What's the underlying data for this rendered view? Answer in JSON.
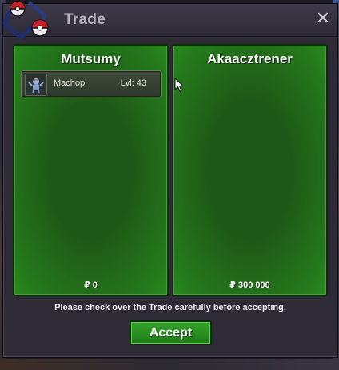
{
  "window": {
    "title": "Trade",
    "close_glyph": "✕"
  },
  "left_panel": {
    "player_name": "Mutsumy",
    "items": [
      {
        "name": "Machop",
        "level": "Lvl: 43",
        "icon": "machop-icon"
      }
    ],
    "money": "₽ 0"
  },
  "right_panel": {
    "player_name": "Akaacztrener",
    "items": [],
    "money": "₽ 300 000"
  },
  "notice": "Please check over the Trade carefully before accepting.",
  "accept_label": "Accept",
  "colors": {
    "panel_green": "#1e5a17",
    "accent_green": "#34a42a",
    "window_bg": "#2e2b36"
  }
}
